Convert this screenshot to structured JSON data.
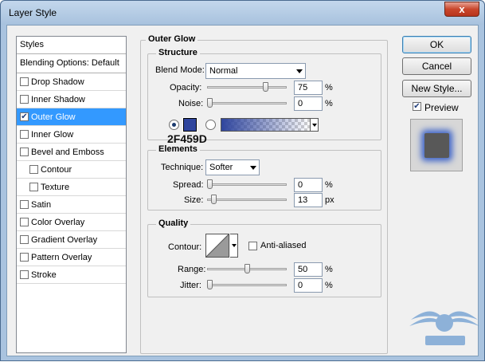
{
  "window": {
    "title": "Layer Style",
    "close_label": "x"
  },
  "sidebar": {
    "header": "Styles",
    "blending": "Blending Options: Default",
    "items": [
      {
        "label": "Drop Shadow",
        "checked": false,
        "selected": false,
        "sub": false
      },
      {
        "label": "Inner Shadow",
        "checked": false,
        "selected": false,
        "sub": false
      },
      {
        "label": "Outer Glow",
        "checked": true,
        "selected": true,
        "sub": false
      },
      {
        "label": "Inner Glow",
        "checked": false,
        "selected": false,
        "sub": false
      },
      {
        "label": "Bevel and Emboss",
        "checked": false,
        "selected": false,
        "sub": false
      },
      {
        "label": "Contour",
        "checked": false,
        "selected": false,
        "sub": true
      },
      {
        "label": "Texture",
        "checked": false,
        "selected": false,
        "sub": true
      },
      {
        "label": "Satin",
        "checked": false,
        "selected": false,
        "sub": false
      },
      {
        "label": "Color Overlay",
        "checked": false,
        "selected": false,
        "sub": false
      },
      {
        "label": "Gradient Overlay",
        "checked": false,
        "selected": false,
        "sub": false
      },
      {
        "label": "Pattern Overlay",
        "checked": false,
        "selected": false,
        "sub": false
      },
      {
        "label": "Stroke",
        "checked": false,
        "selected": false,
        "sub": false
      }
    ]
  },
  "panel": {
    "title": "Outer Glow",
    "structure": {
      "title": "Structure",
      "blend_mode_label": "Blend Mode:",
      "blend_mode_value": "Normal",
      "opacity_label": "Opacity:",
      "opacity_value": "75",
      "opacity_level": 0.75,
      "noise_label": "Noise:",
      "noise_value": "0",
      "noise_level": 0.0,
      "percent": "%",
      "glow_color": "#2F459D",
      "glow_color_hex_label": "2F459D"
    },
    "elements": {
      "title": "Elements",
      "technique_label": "Technique:",
      "technique_value": "Softer",
      "spread_label": "Spread:",
      "spread_value": "0",
      "spread_level": 0.0,
      "size_label": "Size:",
      "size_value": "13",
      "size_level": 0.05,
      "percent": "%",
      "px": "px"
    },
    "quality": {
      "title": "Quality",
      "contour_label": "Contour:",
      "anti_aliased_label": "Anti-aliased",
      "anti_aliased_checked": false,
      "range_label": "Range:",
      "range_value": "50",
      "range_level": 0.5,
      "jitter_label": "Jitter:",
      "jitter_value": "0",
      "jitter_level": 0.0,
      "percent": "%"
    }
  },
  "buttons": {
    "ok": "OK",
    "cancel": "Cancel",
    "new_style": "New Style...",
    "preview_label": "Preview",
    "preview_checked": true
  },
  "colors": {
    "accent_selected": "#3399ff",
    "glow": "#2F459D"
  }
}
